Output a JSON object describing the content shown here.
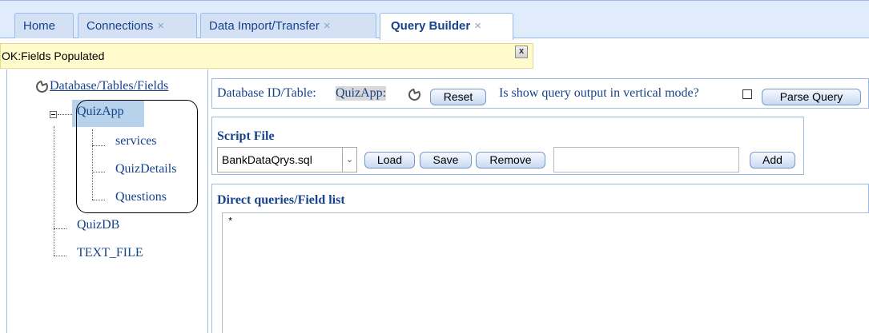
{
  "tabs": [
    {
      "label": "Home",
      "closable": false
    },
    {
      "label": "Connections",
      "closable": true
    },
    {
      "label": "Data Import/Transfer",
      "closable": true
    },
    {
      "label": "Query Builder",
      "closable": true,
      "active": true
    }
  ],
  "close_glyph": "×",
  "status": {
    "message": "OK:Fields Populated",
    "close": "x"
  },
  "tree": {
    "root": "Database/Tables/Fields",
    "nodes": [
      {
        "label": "QuizApp",
        "expanded": true,
        "selected": true,
        "children": [
          "services",
          "QuizDetails",
          "Questions"
        ]
      },
      {
        "label": "QuizDB"
      },
      {
        "label": "TEXT_FILE"
      }
    ]
  },
  "top_bar": {
    "db_label": "Database ID/Table:",
    "db_value": "QuizApp:",
    "reset": "Reset",
    "vertical_label": "Is show query output in vertical mode?",
    "vertical_checked": false,
    "parse": "Parse Query"
  },
  "script_file": {
    "title": "Script File",
    "selected": "BankDataQrys.sql",
    "load": "Load",
    "save": "Save",
    "remove": "Remove",
    "new_name": "",
    "add": "Add"
  },
  "direct": {
    "title": "Direct queries/Field list",
    "text": "*"
  },
  "colors": {
    "accent": "#15428b",
    "tab_border": "#99bbe8",
    "status_bg": "#fffbcc",
    "selection": "#b7d3ec"
  }
}
